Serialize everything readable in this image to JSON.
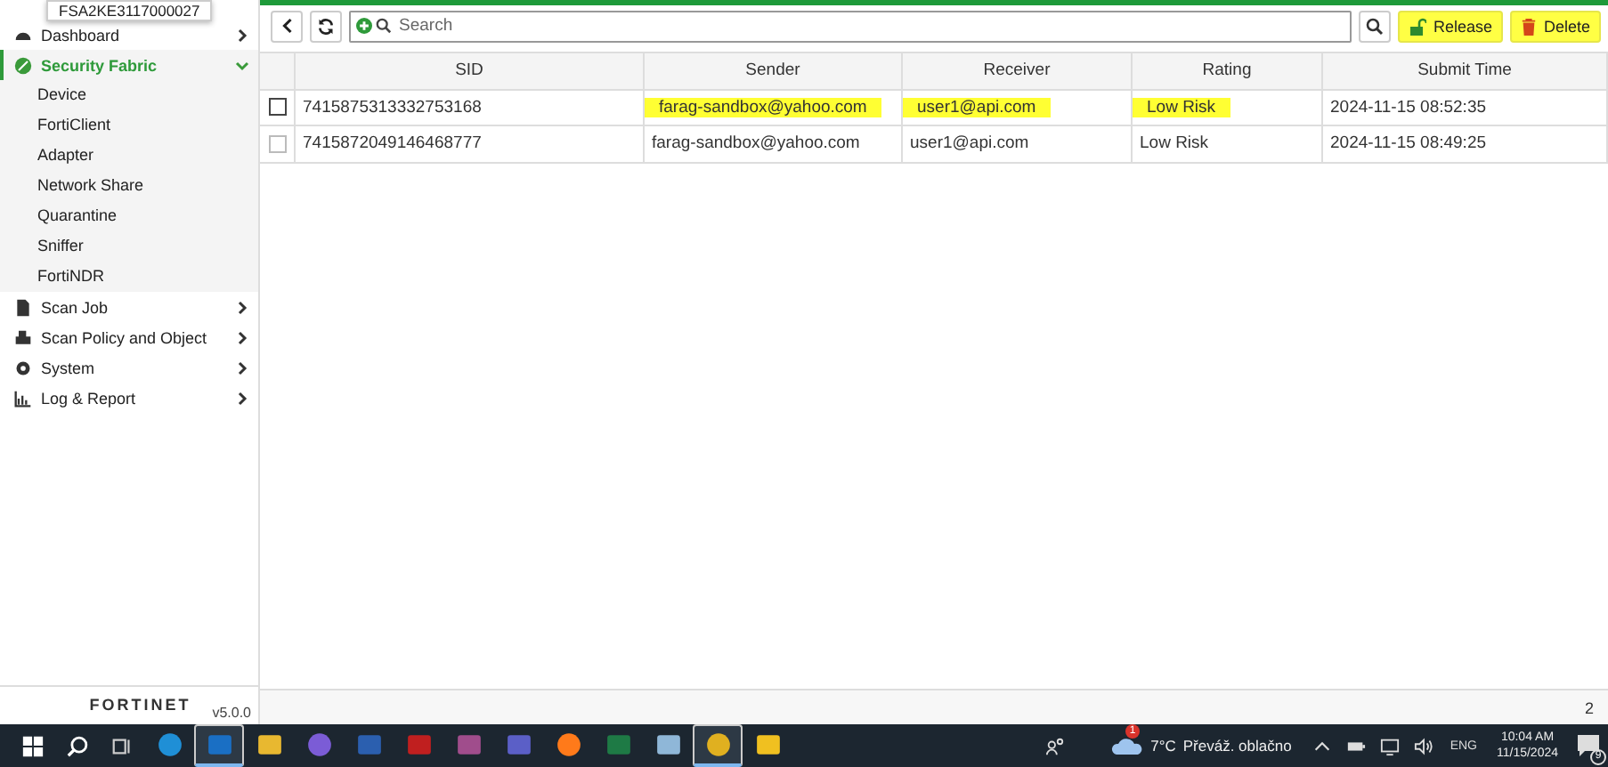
{
  "tooltip": "FSA2KE3117000027",
  "sidebar": {
    "items": [
      {
        "label": "Dashboard",
        "expanded": false,
        "selected": false
      },
      {
        "label": "Security Fabric",
        "expanded": true,
        "selected": true,
        "children": [
          {
            "label": "Device"
          },
          {
            "label": "FortiClient"
          },
          {
            "label": "Adapter"
          },
          {
            "label": "Network Share"
          },
          {
            "label": "Quarantine"
          },
          {
            "label": "Sniffer"
          },
          {
            "label": "FortiNDR"
          }
        ]
      },
      {
        "label": "Scan Job",
        "expanded": false,
        "selected": false
      },
      {
        "label": "Scan Policy and Object",
        "expanded": false,
        "selected": false
      },
      {
        "label": "System",
        "expanded": false,
        "selected": false
      },
      {
        "label": "Log & Report",
        "expanded": false,
        "selected": false
      }
    ],
    "logo": "FORTINET",
    "version": "v5.0.0"
  },
  "toolbar": {
    "search": {
      "placeholder": "Search"
    },
    "buttons": [
      {
        "label": "Release",
        "kind": "release",
        "highlighted": true
      },
      {
        "label": "Delete",
        "kind": "delete",
        "highlighted": true
      }
    ]
  },
  "table": {
    "columns": [
      "SID",
      "Sender",
      "Receiver",
      "Rating",
      "Submit Time"
    ],
    "rows": [
      {
        "checked": false,
        "cells": [
          {
            "text": "7415875313332753168",
            "highlighted": false
          },
          {
            "text": "farag-sandbox@yahoo.com",
            "highlighted": true
          },
          {
            "text": "user1@api.com",
            "highlighted": true
          },
          {
            "text": "Low Risk",
            "highlighted": true
          },
          {
            "text": "2024-11-15 08:52:35",
            "highlighted": false
          }
        ]
      },
      {
        "checked": false,
        "cells": [
          {
            "text": "7415872049146468777",
            "highlighted": false
          },
          {
            "text": "farag-sandbox@yahoo.com",
            "highlighted": false
          },
          {
            "text": "user1@api.com",
            "highlighted": false
          },
          {
            "text": "Low Risk",
            "highlighted": false
          },
          {
            "text": "2024-11-15 08:49:25",
            "highlighted": false
          }
        ]
      }
    ]
  },
  "footer": {
    "count": "2"
  },
  "taskbar": {
    "apps": [
      {
        "kind": "edge",
        "active": false
      },
      {
        "kind": "outlook",
        "active": true
      },
      {
        "kind": "files",
        "active": false
      },
      {
        "kind": "clipchamp",
        "active": false
      },
      {
        "kind": "word",
        "active": false
      },
      {
        "kind": "pdf",
        "active": false
      },
      {
        "kind": "archive",
        "active": false
      },
      {
        "kind": "teams",
        "active": false
      },
      {
        "kind": "firefox",
        "active": false
      },
      {
        "kind": "excel",
        "active": false
      },
      {
        "kind": "notes",
        "active": false
      },
      {
        "kind": "chrome",
        "active": true
      },
      {
        "kind": "mail",
        "active": false
      }
    ],
    "weather_badge": "1",
    "weather": "7°C",
    "weather_text": "Převáž. oblačno",
    "language": "ENG",
    "time": "10:04 AM",
    "date": "11/15/2024",
    "notifications": "9"
  }
}
